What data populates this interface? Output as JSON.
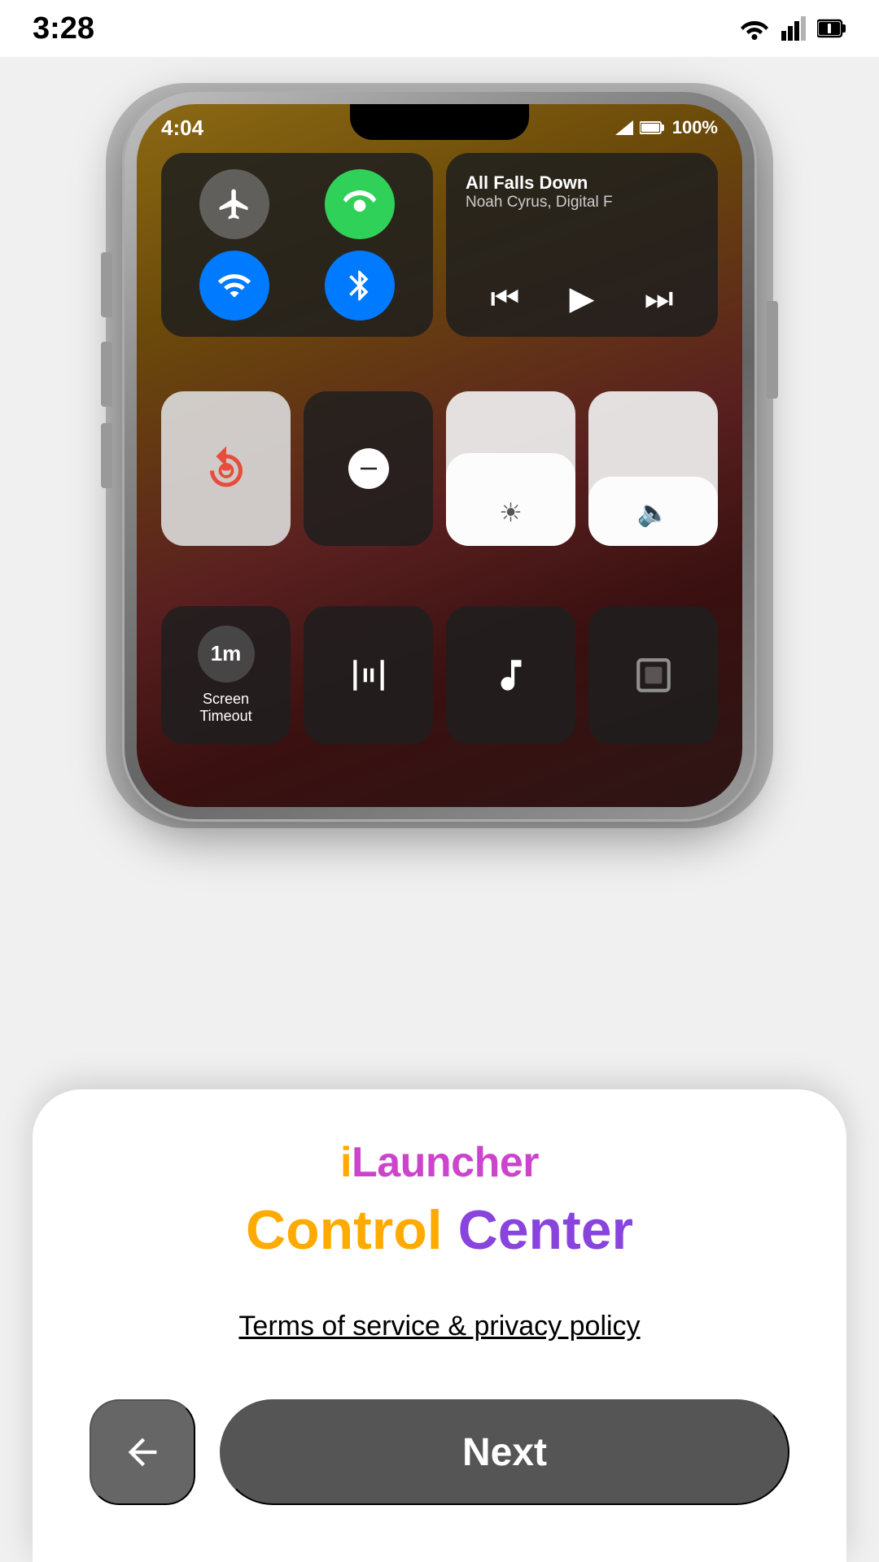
{
  "statusBar": {
    "time": "3:28",
    "icons": [
      "wifi",
      "signal",
      "battery"
    ]
  },
  "phone": {
    "statusTime": "4:04",
    "battery": "100%",
    "music": {
      "title": "All Falls Down",
      "artist": "Noah Cyrus, Digital F"
    },
    "screenTimeout": {
      "value": "1m",
      "label": "Screen\nTimeout"
    }
  },
  "card": {
    "appName": {
      "prefix": "i",
      "suffix": "Launcher"
    },
    "subtitle": {
      "word1": "Control",
      "word2": "Center"
    },
    "termsLabel": "Terms of service & privacy policy",
    "backArrow": "←",
    "nextLabel": "Next"
  }
}
